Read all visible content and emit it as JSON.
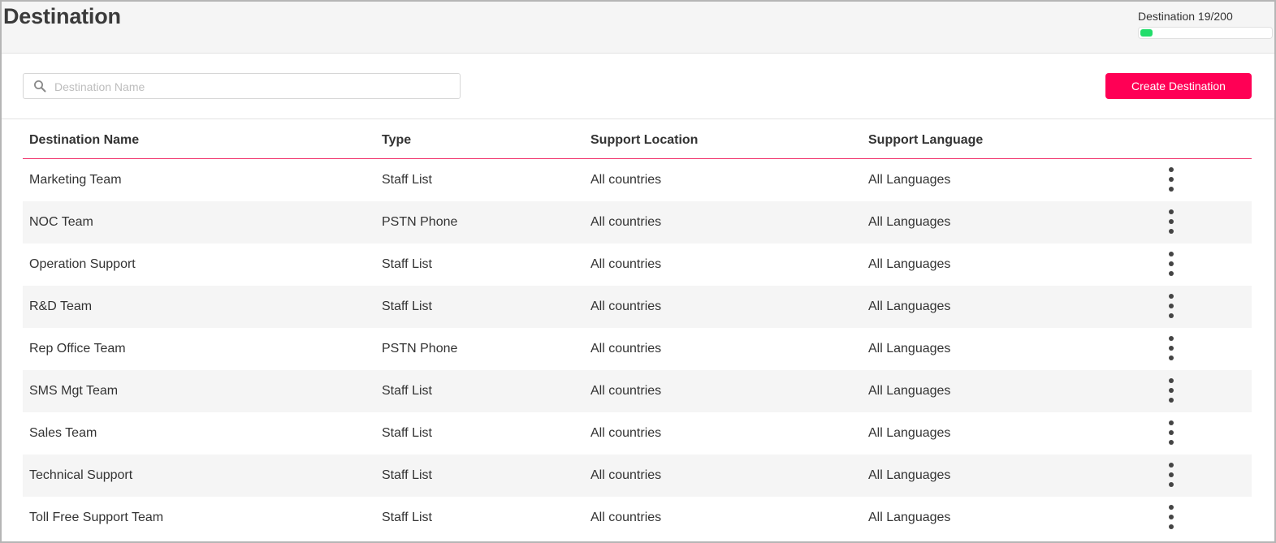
{
  "header": {
    "title": "Destination",
    "quota": {
      "label": "Destination 19/200",
      "used": 19,
      "total": 200,
      "fill_color": "#22dd6b"
    }
  },
  "toolbar": {
    "search": {
      "placeholder": "Destination Name",
      "value": ""
    },
    "create_label": "Create Destination",
    "accent_color": "#ff0055"
  },
  "table": {
    "columns": [
      "Destination Name",
      "Type",
      "Support Location",
      "Support Language"
    ],
    "rows": [
      {
        "name": "Marketing Team",
        "type": "Staff List",
        "location": "All countries",
        "language": "All Languages"
      },
      {
        "name": "NOC Team",
        "type": "PSTN Phone",
        "location": "All countries",
        "language": "All Languages"
      },
      {
        "name": "Operation Support",
        "type": "Staff List",
        "location": "All countries",
        "language": "All Languages"
      },
      {
        "name": "R&D Team",
        "type": "Staff List",
        "location": "All countries",
        "language": "All Languages"
      },
      {
        "name": "Rep Office Team",
        "type": "PSTN Phone",
        "location": "All countries",
        "language": "All Languages"
      },
      {
        "name": "SMS Mgt Team",
        "type": "Staff List",
        "location": "All countries",
        "language": "All Languages"
      },
      {
        "name": "Sales Team",
        "type": "Staff List",
        "location": "All countries",
        "language": "All Languages"
      },
      {
        "name": "Technical Support",
        "type": "Staff List",
        "location": "All countries",
        "language": "All Languages"
      },
      {
        "name": "Toll Free Support Team",
        "type": "Staff List",
        "location": "All countries",
        "language": "All Languages"
      }
    ],
    "row_action_icon": "more-vertical-icon"
  }
}
